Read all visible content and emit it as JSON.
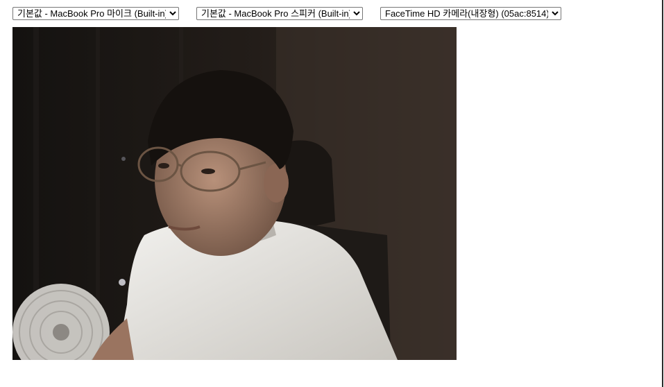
{
  "devices": {
    "microphone": {
      "selected": "기본값 - MacBook Pro 마이크 (Built-in)",
      "options": [
        "기본값 - MacBook Pro 마이크 (Built-in)"
      ]
    },
    "speaker": {
      "selected": "기본값 - MacBook Pro 스피커 (Built-in)",
      "options": [
        "기본값 - MacBook Pro 스피커 (Built-in)"
      ]
    },
    "camera": {
      "selected": "FaceTime HD 카메라(내장형) (05ac:8514)",
      "options": [
        "FaceTime HD 카메라(내장형) (05ac:8514)"
      ]
    }
  },
  "video": {
    "subject": "webcam-feed",
    "colors": {
      "background": "#1c1815",
      "wall": "#3a3029",
      "shirt": "#e8e6e1",
      "hair": "#15110e",
      "skin": "#b58a6e"
    }
  }
}
